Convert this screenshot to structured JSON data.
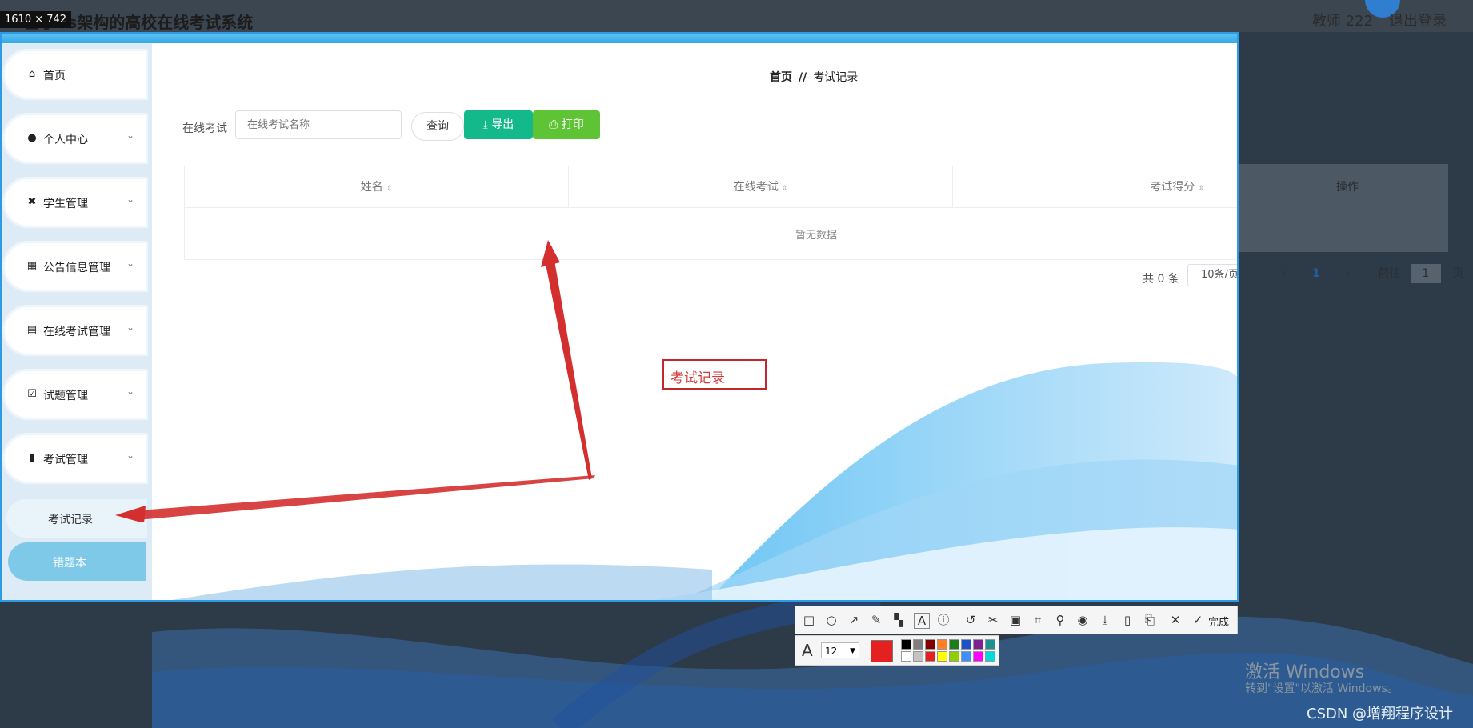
{
  "app": {
    "title": "基于bs架构的高校在线考试系统",
    "size_badge": "1610 × 742",
    "user_label": "教师 222",
    "logout_label": "退出登录"
  },
  "sidebar": {
    "items": [
      {
        "label": "首页",
        "icon": "home-icon",
        "has_chevron": false
      },
      {
        "label": "个人中心",
        "icon": "user-icon",
        "has_chevron": true
      },
      {
        "label": "学生管理",
        "icon": "student-icon",
        "has_chevron": true
      },
      {
        "label": "公告信息管理",
        "icon": "grid-icon",
        "has_chevron": true
      },
      {
        "label": "在线考试管理",
        "icon": "clipboard-icon",
        "has_chevron": true
      },
      {
        "label": "试题管理",
        "icon": "clipboard-check-icon",
        "has_chevron": true
      },
      {
        "label": "考试管理",
        "icon": "bar-chart-icon",
        "has_chevron": true
      }
    ],
    "sub_items": [
      {
        "label": "考试记录"
      },
      {
        "label": "错题本"
      }
    ]
  },
  "breadcrumb": {
    "home": "首页",
    "separator": "//",
    "current": "考试记录"
  },
  "search": {
    "label": "在线考试",
    "placeholder": "在线考试名称",
    "query_label": "查询",
    "export_label": "导出",
    "print_label": "打印"
  },
  "table": {
    "columns": [
      "姓名",
      "在线考试",
      "考试得分",
      "操作"
    ],
    "empty_text": "暂无数据"
  },
  "pagination": {
    "total_text": "共 0 条",
    "page_size": "10条/页",
    "current_page": "1",
    "goto_label": "前往",
    "goto_value": "1",
    "page_suffix": "页"
  },
  "annotation": {
    "text": "考试记录"
  },
  "toolbar": {
    "done_label": "完成",
    "font_size": "12",
    "current_color": "#e42121",
    "palette": [
      "#000000",
      "#7f7f7f",
      "#7f0000",
      "#ff7f27",
      "#1e7b1e",
      "#2050c8",
      "#7f1f8f",
      "#1f8f8f",
      "#ffffff",
      "#c3c3c3",
      "#e42121",
      "#ffff00",
      "#8fce00",
      "#3f8fff",
      "#ff00ff",
      "#00dada"
    ]
  },
  "watermark": {
    "activate_title": "激活 Windows",
    "activate_sub": "转到\"设置\"以激活 Windows。",
    "csdn": "CSDN @增翔程序设计"
  },
  "colors": {
    "accent": "#2d9ae6",
    "export_btn": "#13b98a",
    "print_btn": "#5ec335",
    "annotation_red": "#c0282d",
    "sidebar_bg": "#dcebf6",
    "sub_active": "#7ec9e8"
  }
}
